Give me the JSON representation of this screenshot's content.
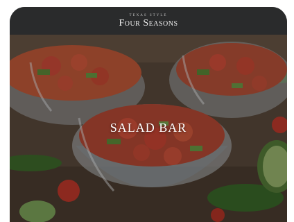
{
  "header": {
    "logo_top": "TEXAS STYLE",
    "logo_main": "Four Seasons"
  },
  "hero": {
    "title": "SALAD BAR",
    "image": "salad-cups-photo"
  },
  "colors": {
    "header_bg": "#2a2b2c",
    "title_text": "#ffffff"
  }
}
